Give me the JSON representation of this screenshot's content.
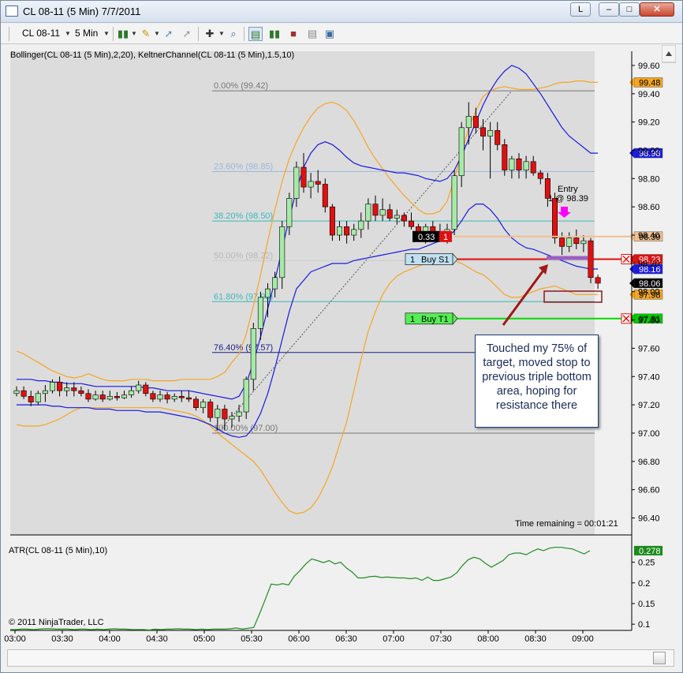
{
  "window": {
    "title": "CL 08-11 (5 Min)  7/7/2011",
    "title_button": "L"
  },
  "toolbar": {
    "instrument": "CL 08-11",
    "interval": "5 Min"
  },
  "chart": {
    "indicator_label": "Bollinger(CL 08-11 (5 Min),2,20), KeltnerChannel(CL 08-11 (5 Min),1.5,10)",
    "atr_label": "ATR(CL 08-11 (5 Min),10)",
    "copyright": "© 2011 NinjaTrader, LLC",
    "time_remaining": "Time remaining = 00:01:21",
    "entry_label_1": "Entry",
    "entry_label_2": "1 @ 98.39",
    "order_stop_qty": "1",
    "order_stop_label": "Buy S1",
    "order_target_qty": "1",
    "order_target_label": "Buy T1",
    "pnl_value": "0.33",
    "pnl_qty": "1",
    "note": "Touched my 75% of target, moved stop to previous triple bottom area, hoping for resistance there",
    "colors": {
      "bull_candle": "#a6eaa6",
      "bear_candle": "#e01010",
      "bollinger": "#f5a623",
      "keltner": "#1a1ae0",
      "atr_line": "#228b22",
      "panel_bg": "#dcdcdc"
    }
  },
  "chart_data": {
    "type": "candlestick",
    "y_axis_labels": [
      "99.60",
      "99.40",
      "99.20",
      "99.00",
      "98.80",
      "98.60",
      "98.40",
      "98.20",
      "98.00",
      "97.80",
      "97.60",
      "97.40",
      "97.20",
      "97.00",
      "96.80",
      "96.60",
      "96.40"
    ],
    "ylim": [
      96.28,
      99.7
    ],
    "x_axis_labels": [
      "03:00",
      "03:30",
      "04:00",
      "04:30",
      "05:00",
      "05:30",
      "06:00",
      "06:30",
      "07:00",
      "07:30",
      "08:00",
      "08:30",
      "09:00"
    ],
    "price_markers": [
      {
        "value": "99.48",
        "price": 99.48,
        "color": "#f5a623"
      },
      {
        "value": "98.98",
        "price": 98.98,
        "color": "#1a1ae0"
      },
      {
        "value": "98.39",
        "price": 98.39,
        "color": "#f0c090"
      },
      {
        "value": "98.23",
        "price": 98.23,
        "color": "#e01010"
      },
      {
        "value": "98.16",
        "price": 98.16,
        "color": "#1a1ae0"
      },
      {
        "value": "98.06",
        "price": 98.06,
        "color": "#000000"
      },
      {
        "value": "97.98",
        "price": 97.98,
        "color": "#f5a623"
      },
      {
        "value": "97.81",
        "price": 97.81,
        "color": "#00cc00"
      }
    ],
    "fib_levels": [
      {
        "label": "0.00% (99.42)",
        "price": 99.42,
        "color": "#777777"
      },
      {
        "label": "23.60% (98.85)",
        "price": 98.85,
        "color": "#9ab8d8"
      },
      {
        "label": "38.20% (98.50)",
        "price": 98.5,
        "color": "#3cb8b8"
      },
      {
        "label": "50.00% (98.22)",
        "price": 98.22,
        "color": "#cccccc"
      },
      {
        "label": "61.80% (97.93)",
        "price": 97.93,
        "color": "#3cb8b8"
      },
      {
        "label": "76.40% (97.57)",
        "price": 97.57,
        "color": "#1a1a8a"
      },
      {
        "label": "100.00% (97.00)",
        "price": 97.0,
        "color": "#777777"
      }
    ],
    "atr_axis_labels": [
      "0.25",
      "0.2",
      "0.15",
      "0.1"
    ],
    "atr_ylim": [
      0.085,
      0.295
    ],
    "atr_current": "0.278",
    "atr_values": [
      0.087,
      0.087,
      0.088,
      0.088,
      0.087,
      0.088,
      0.089,
      0.089,
      0.088,
      0.088,
      0.088,
      0.087,
      0.088,
      0.088,
      0.087,
      0.088,
      0.087,
      0.088,
      0.089,
      0.088,
      0.088,
      0.087,
      0.087,
      0.087,
      0.086,
      0.088,
      0.087,
      0.088,
      0.088,
      0.089,
      0.088,
      0.088,
      0.087,
      0.088,
      0.087,
      0.088,
      0.088,
      0.088,
      0.089,
      0.091,
      0.088,
      0.09,
      0.092,
      0.125,
      0.16,
      0.197,
      0.195,
      0.198,
      0.195,
      0.216,
      0.23,
      0.246,
      0.258,
      0.254,
      0.249,
      0.254,
      0.246,
      0.25,
      0.236,
      0.226,
      0.212,
      0.212,
      0.215,
      0.216,
      0.213,
      0.214,
      0.213,
      0.212,
      0.212,
      0.21,
      0.212,
      0.206,
      0.214,
      0.206,
      0.206,
      0.21,
      0.214,
      0.224,
      0.242,
      0.256,
      0.262,
      0.258,
      0.247,
      0.238,
      0.246,
      0.254,
      0.268,
      0.272,
      0.272,
      0.268,
      0.276,
      0.282,
      0.278,
      0.284,
      0.286,
      0.286,
      0.284,
      0.282,
      0.276,
      0.27,
      0.278
    ],
    "candles": [
      [
        97.28,
        97.33,
        97.26,
        97.3
      ],
      [
        97.3,
        97.33,
        97.24,
        97.26
      ],
      [
        97.26,
        97.3,
        97.19,
        97.22
      ],
      [
        97.22,
        97.3,
        97.2,
        97.28
      ],
      [
        97.28,
        97.34,
        97.22,
        97.3
      ],
      [
        97.3,
        97.38,
        97.28,
        97.36
      ],
      [
        97.36,
        97.4,
        97.26,
        97.3
      ],
      [
        97.3,
        97.36,
        97.26,
        97.32
      ],
      [
        97.32,
        97.36,
        97.26,
        97.3
      ],
      [
        97.3,
        97.33,
        97.26,
        97.28
      ],
      [
        97.28,
        97.31,
        97.22,
        97.24
      ],
      [
        97.24,
        97.3,
        97.23,
        97.27
      ],
      [
        97.27,
        97.3,
        97.22,
        97.24
      ],
      [
        97.24,
        97.3,
        97.23,
        97.26
      ],
      [
        97.26,
        97.29,
        97.23,
        97.25
      ],
      [
        97.25,
        97.3,
        97.24,
        97.27
      ],
      [
        97.27,
        97.33,
        97.25,
        97.3
      ],
      [
        97.3,
        97.37,
        97.28,
        97.34
      ],
      [
        97.34,
        97.36,
        97.26,
        97.28
      ],
      [
        97.28,
        97.3,
        97.22,
        97.24
      ],
      [
        97.24,
        97.3,
        97.22,
        97.27
      ],
      [
        97.27,
        97.29,
        97.21,
        97.24
      ],
      [
        97.24,
        97.28,
        97.22,
        97.26
      ],
      [
        97.26,
        97.3,
        97.22,
        97.25
      ],
      [
        97.25,
        97.3,
        97.22,
        97.24
      ],
      [
        97.24,
        97.26,
        97.16,
        97.18
      ],
      [
        97.18,
        97.24,
        97.14,
        97.22
      ],
      [
        97.22,
        97.24,
        97.08,
        97.11
      ],
      [
        97.11,
        97.2,
        97.02,
        97.17
      ],
      [
        97.17,
        97.2,
        97.02,
        97.1
      ],
      [
        97.1,
        97.15,
        97.04,
        97.12
      ],
      [
        97.12,
        97.2,
        97.08,
        97.15
      ],
      [
        97.15,
        97.4,
        97.1,
        97.38
      ],
      [
        97.38,
        97.78,
        97.3,
        97.74
      ],
      [
        97.74,
        98.0,
        97.66,
        97.96
      ],
      [
        97.96,
        98.06,
        97.82,
        98.02
      ],
      [
        98.02,
        98.14,
        97.96,
        98.1
      ],
      [
        98.1,
        98.5,
        98.02,
        98.46
      ],
      [
        98.46,
        98.7,
        98.4,
        98.66
      ],
      [
        98.66,
        98.92,
        98.6,
        98.88
      ],
      [
        98.88,
        98.98,
        98.7,
        98.74
      ],
      [
        98.74,
        98.84,
        98.66,
        98.78
      ],
      [
        98.78,
        98.86,
        98.7,
        98.76
      ],
      [
        98.76,
        98.8,
        98.56,
        98.6
      ],
      [
        98.6,
        98.62,
        98.36,
        98.4
      ],
      [
        98.4,
        98.5,
        98.36,
        98.46
      ],
      [
        98.46,
        98.5,
        98.34,
        98.4
      ],
      [
        98.4,
        98.48,
        98.36,
        98.44
      ],
      [
        98.44,
        98.56,
        98.38,
        98.5
      ],
      [
        98.5,
        98.66,
        98.44,
        98.62
      ],
      [
        98.62,
        98.68,
        98.5,
        98.54
      ],
      [
        98.54,
        98.66,
        98.5,
        98.58
      ],
      [
        98.58,
        98.62,
        98.5,
        98.52
      ],
      [
        98.52,
        98.58,
        98.48,
        98.54
      ],
      [
        98.54,
        98.56,
        98.46,
        98.5
      ],
      [
        98.5,
        98.56,
        98.44,
        98.46
      ],
      [
        98.46,
        98.48,
        98.36,
        98.38
      ],
      [
        98.38,
        98.48,
        98.34,
        98.46
      ],
      [
        98.46,
        98.5,
        98.36,
        98.4
      ],
      [
        98.4,
        98.48,
        98.36,
        98.38
      ],
      [
        98.38,
        98.48,
        98.34,
        98.44
      ],
      [
        98.44,
        98.86,
        98.4,
        98.82
      ],
      [
        98.82,
        99.2,
        98.74,
        99.16
      ],
      [
        99.16,
        99.34,
        99.04,
        99.24
      ],
      [
        99.24,
        99.3,
        99.12,
        99.16
      ],
      [
        99.16,
        99.22,
        99.0,
        99.1
      ],
      [
        99.1,
        99.2,
        98.8,
        99.14
      ],
      [
        99.14,
        99.2,
        99.0,
        99.04
      ],
      [
        99.04,
        99.08,
        98.82,
        98.86
      ],
      [
        98.86,
        98.96,
        98.8,
        98.94
      ],
      [
        98.94,
        98.98,
        98.8,
        98.86
      ],
      [
        98.86,
        98.96,
        98.8,
        98.92
      ],
      [
        98.92,
        98.96,
        98.82,
        98.84
      ],
      [
        98.84,
        98.86,
        98.76,
        98.8
      ],
      [
        98.8,
        98.84,
        98.6,
        98.66
      ],
      [
        98.66,
        98.7,
        98.34,
        98.38
      ],
      [
        98.38,
        98.42,
        98.26,
        98.32
      ],
      [
        98.32,
        98.42,
        98.28,
        98.38
      ],
      [
        98.38,
        98.44,
        98.3,
        98.34
      ],
      [
        98.34,
        98.4,
        98.28,
        98.36
      ],
      [
        98.36,
        98.38,
        98.06,
        98.1
      ],
      [
        98.1,
        98.12,
        98.02,
        98.06
      ]
    ],
    "bollinger_upper": [
      97.58,
      97.56,
      97.53,
      97.5,
      97.47,
      97.44,
      97.42,
      97.4,
      97.39,
      97.4,
      97.42,
      97.4,
      97.38,
      97.37,
      97.37,
      97.37,
      97.38,
      97.38,
      97.38,
      97.37,
      97.37,
      97.37,
      97.37,
      97.38,
      97.38,
      97.38,
      97.38,
      97.38,
      97.4,
      97.43,
      97.5,
      97.56,
      97.7,
      97.9,
      98.12,
      98.36,
      98.58,
      98.78,
      98.94,
      99.06,
      99.16,
      99.24,
      99.3,
      99.33,
      99.34,
      99.32,
      99.28,
      99.21,
      99.12,
      99.02,
      98.94,
      98.87,
      98.8,
      98.74,
      98.68,
      98.63,
      98.58,
      98.55,
      98.55,
      98.57,
      98.64,
      98.8,
      98.98,
      99.16,
      99.28,
      99.38,
      99.42,
      99.44,
      99.45,
      99.44,
      99.43,
      99.43,
      99.43,
      99.44,
      99.45,
      99.47,
      99.48,
      99.48,
      99.49,
      99.49,
      99.48,
      99.48
    ],
    "bollinger_lower": [
      97.06,
      97.05,
      97.05,
      97.05,
      97.06,
      97.08,
      97.1,
      97.13,
      97.16,
      97.18,
      97.18,
      97.18,
      97.18,
      97.18,
      97.18,
      97.18,
      97.18,
      97.18,
      97.18,
      97.18,
      97.18,
      97.17,
      97.16,
      97.15,
      97.14,
      97.12,
      97.09,
      97.05,
      97.0,
      96.96,
      96.92,
      96.88,
      96.84,
      96.8,
      96.74,
      96.66,
      96.58,
      96.51,
      96.45,
      96.43,
      96.44,
      96.47,
      96.54,
      96.64,
      96.76,
      96.92,
      97.08,
      97.3,
      97.52,
      97.72,
      97.86,
      97.98,
      98.06,
      98.11,
      98.14,
      98.16,
      98.18,
      98.2,
      98.22,
      98.24,
      98.24,
      98.22,
      98.2,
      98.17,
      98.14,
      98.12,
      98.08,
      98.03,
      97.98,
      97.96,
      97.96,
      97.98,
      98.0,
      98.02,
      98.03,
      98.04,
      98.02,
      98.0,
      97.98,
      97.98,
      97.98,
      97.98
    ],
    "keltner_upper": [
      97.38,
      97.38,
      97.38,
      97.37,
      97.37,
      97.36,
      97.36,
      97.35,
      97.35,
      97.35,
      97.34,
      97.33,
      97.33,
      97.33,
      97.33,
      97.33,
      97.33,
      97.33,
      97.32,
      97.32,
      97.31,
      97.3,
      97.3,
      97.3,
      97.3,
      97.29,
      97.28,
      97.27,
      97.26,
      97.25,
      97.24,
      97.26,
      97.35,
      97.5,
      97.68,
      97.88,
      98.08,
      98.3,
      98.52,
      98.72,
      98.88,
      98.98,
      99.04,
      99.06,
      99.04,
      99.0,
      98.95,
      98.91,
      98.89,
      98.88,
      98.87,
      98.86,
      98.85,
      98.84,
      98.84,
      98.83,
      98.82,
      98.8,
      98.79,
      98.78,
      98.8,
      98.86,
      98.96,
      99.08,
      99.2,
      99.32,
      99.42,
      99.5,
      99.56,
      99.6,
      99.58,
      99.54,
      99.47,
      99.4,
      99.32,
      99.24,
      99.16,
      99.1,
      99.06,
      99.02,
      98.98,
      98.98
    ],
    "keltner_lower": [
      97.2,
      97.2,
      97.2,
      97.2,
      97.2,
      97.19,
      97.19,
      97.18,
      97.18,
      97.18,
      97.18,
      97.17,
      97.17,
      97.17,
      97.16,
      97.16,
      97.16,
      97.16,
      97.15,
      97.15,
      97.15,
      97.14,
      97.13,
      97.12,
      97.11,
      97.1,
      97.08,
      97.06,
      97.03,
      97.0,
      96.98,
      96.97,
      96.98,
      97.04,
      97.14,
      97.28,
      97.46,
      97.66,
      97.86,
      98.02,
      98.08,
      98.14,
      98.16,
      98.18,
      98.2,
      98.2,
      98.2,
      98.22,
      98.23,
      98.24,
      98.25,
      98.26,
      98.27,
      98.28,
      98.29,
      98.3,
      98.3,
      98.32,
      98.34,
      98.36,
      98.38,
      98.43,
      98.5,
      98.58,
      98.62,
      98.62,
      98.58,
      98.52,
      98.44,
      98.38,
      98.34,
      98.31,
      98.3,
      98.28,
      98.26,
      98.24,
      98.22,
      98.2,
      98.18,
      98.17,
      98.16,
      98.16
    ]
  }
}
